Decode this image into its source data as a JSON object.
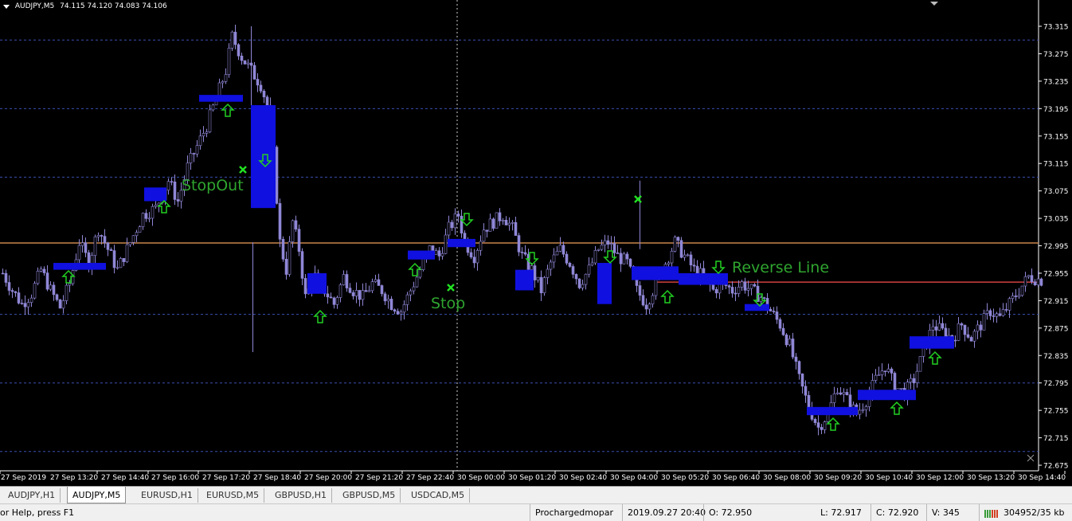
{
  "header": {
    "symbol": "AUDJPY,M5",
    "quote": "74.115 74.120 74.083 74.106"
  },
  "chart_data": {
    "type": "candlestick",
    "symbol": "AUDJPY",
    "timeframe": "M5",
    "y_ticks": [
      "73.315",
      "73.275",
      "73.235",
      "73.195",
      "73.155",
      "73.115",
      "73.075",
      "73.035",
      "72.995",
      "72.955",
      "72.915",
      "72.875",
      "72.835",
      "72.795",
      "72.755",
      "72.715",
      "72.675"
    ],
    "ylim": [
      72.675,
      73.315
    ],
    "x_ticks": [
      "27 Sep 2019",
      "27 Sep 13:20",
      "27 Sep 14:40",
      "27 Sep 16:00",
      "27 Sep 17:20",
      "27 Sep 18:40",
      "27 Sep 20:00",
      "27 Sep 21:20",
      "27 Sep 22:40",
      "30 Sep 00:00",
      "30 Sep 01:20",
      "30 Sep 02:40",
      "30 Sep 04:00",
      "30 Sep 05:20",
      "30 Sep 06:40",
      "30 Sep 08:00",
      "30 Sep 09:20",
      "30 Sep 10:40",
      "30 Sep 12:00",
      "30 Sep 13:20",
      "30 Sep 14:40"
    ],
    "price_path": [
      [
        0,
        72.955
      ],
      [
        3,
        72.93
      ],
      [
        6,
        72.91
      ],
      [
        9,
        72.925
      ],
      [
        12,
        72.96
      ],
      [
        15,
        72.93
      ],
      [
        18,
        72.905
      ],
      [
        21,
        72.94
      ],
      [
        24,
        73.0
      ],
      [
        27,
        72.97
      ],
      [
        30,
        73.02
      ],
      [
        33,
        72.99
      ],
      [
        36,
        72.96
      ],
      [
        40,
        73.0
      ],
      [
        44,
        73.04
      ],
      [
        48,
        73.05
      ],
      [
        52,
        73.09
      ],
      [
        55,
        73.06
      ],
      [
        58,
        73.11
      ],
      [
        61,
        73.14
      ],
      [
        64,
        73.17
      ],
      [
        67,
        73.21
      ],
      [
        70,
        73.25
      ],
      [
        72,
        73.3
      ],
      [
        75,
        73.27
      ],
      [
        78,
        73.25
      ],
      [
        81,
        73.23
      ],
      [
        83,
        73.2
      ],
      [
        85,
        73.13
      ],
      [
        87,
        73.0
      ],
      [
        89,
        72.96
      ],
      [
        91,
        73.03
      ],
      [
        93,
        72.99
      ],
      [
        95,
        72.92
      ],
      [
        98,
        72.95
      ],
      [
        101,
        72.93
      ],
      [
        104,
        72.91
      ],
      [
        107,
        72.95
      ],
      [
        110,
        72.93
      ],
      [
        113,
        72.92
      ],
      [
        116,
        72.94
      ],
      [
        119,
        72.93
      ],
      [
        122,
        72.91
      ],
      [
        125,
        72.9
      ],
      [
        128,
        72.93
      ],
      [
        131,
        72.96
      ],
      [
        134,
        72.99
      ],
      [
        137,
        72.98
      ],
      [
        140,
        73.02
      ],
      [
        143,
        73.04
      ],
      [
        145,
        73.0
      ],
      [
        148,
        72.98
      ],
      [
        151,
        73.02
      ],
      [
        154,
        73.03
      ],
      [
        157,
        73.04
      ],
      [
        160,
        73.02
      ],
      [
        163,
        72.98
      ],
      [
        166,
        72.96
      ],
      [
        169,
        72.93
      ],
      [
        172,
        72.97
      ],
      [
        175,
        72.99
      ],
      [
        178,
        72.97
      ],
      [
        181,
        72.94
      ],
      [
        184,
        72.96
      ],
      [
        187,
        72.99
      ],
      [
        190,
        73.0
      ],
      [
        193,
        72.98
      ],
      [
        196,
        72.97
      ],
      [
        199,
        72.93
      ],
      [
        202,
        72.91
      ],
      [
        205,
        72.94
      ],
      [
        208,
        72.97
      ],
      [
        211,
        73.0
      ],
      [
        214,
        72.98
      ],
      [
        217,
        72.96
      ],
      [
        220,
        72.95
      ],
      [
        223,
        72.93
      ],
      [
        226,
        72.94
      ],
      [
        229,
        72.93
      ],
      [
        232,
        72.94
      ],
      [
        235,
        72.93
      ],
      [
        238,
        72.92
      ],
      [
        241,
        72.9
      ],
      [
        244,
        72.88
      ],
      [
        247,
        72.85
      ],
      [
        250,
        72.8
      ],
      [
        253,
        72.76
      ],
      [
        256,
        72.73
      ],
      [
        259,
        72.75
      ],
      [
        262,
        72.79
      ],
      [
        265,
        72.77
      ],
      [
        268,
        72.75
      ],
      [
        271,
        72.77
      ],
      [
        274,
        72.8
      ],
      [
        277,
        72.82
      ],
      [
        280,
        72.79
      ],
      [
        283,
        72.78
      ],
      [
        286,
        72.8
      ],
      [
        289,
        72.84
      ],
      [
        292,
        72.88
      ],
      [
        295,
        72.87
      ],
      [
        298,
        72.86
      ],
      [
        301,
        72.88
      ],
      [
        304,
        72.86
      ],
      [
        307,
        72.88
      ],
      [
        310,
        72.9
      ],
      [
        313,
        72.89
      ],
      [
        316,
        72.91
      ],
      [
        319,
        72.93
      ],
      [
        322,
        72.95
      ],
      [
        326,
        72.945
      ]
    ],
    "horizontal_lines": [
      {
        "price": 72.999,
        "color": "#c8864a",
        "label": "current-price-line"
      },
      {
        "price": 72.942,
        "color": "#d04040",
        "label": "Reverse Line",
        "x_start_fraction": 0.63
      }
    ],
    "annotations": [
      {
        "text": "StopOut",
        "color": "#2fa52f"
      },
      {
        "text": "Stop",
        "color": "#2fa52f"
      },
      {
        "text": "Reverse Line",
        "color": "#2fa52f"
      }
    ],
    "signal_boxes": [
      {
        "kind": "buy",
        "lo": 72.96,
        "hi": 72.97
      },
      {
        "kind": "buy",
        "lo": 73.06,
        "hi": 73.08
      },
      {
        "kind": "buy",
        "lo": 73.205,
        "hi": 73.215
      },
      {
        "kind": "sell",
        "lo": 73.05,
        "hi": 73.2
      },
      {
        "kind": "buy",
        "lo": 72.925,
        "hi": 72.955
      },
      {
        "kind": "buy",
        "lo": 72.975,
        "hi": 72.988
      },
      {
        "kind": "sell",
        "lo": 72.993,
        "hi": 73.005
      },
      {
        "kind": "sell",
        "lo": 72.93,
        "hi": 72.96
      },
      {
        "kind": "sell",
        "lo": 72.91,
        "hi": 72.97
      },
      {
        "kind": "sell",
        "lo": 72.945,
        "hi": 72.965
      },
      {
        "kind": "sell",
        "lo": 72.938,
        "hi": 72.955
      },
      {
        "kind": "sell",
        "lo": 72.9,
        "hi": 72.91
      },
      {
        "kind": "buy",
        "lo": 72.748,
        "hi": 72.76
      },
      {
        "kind": "buy",
        "lo": 72.77,
        "hi": 72.785
      },
      {
        "kind": "buy",
        "lo": 72.845,
        "hi": 72.863
      }
    ],
    "arrows": {
      "up_count": 12,
      "down_count": 5
    },
    "stop_markers": 3,
    "grid": true,
    "background": "#000000",
    "candle_color": "#8f87d6"
  },
  "tabs": [
    {
      "label": "AUDJPY,H1",
      "active": false
    },
    {
      "label": "AUDJPY,M5",
      "active": true
    },
    {
      "label": "EURUSD,H1",
      "active": false
    },
    {
      "label": "EURUSD,M5",
      "active": false
    },
    {
      "label": "GBPUSD,H1",
      "active": false
    },
    {
      "label": "GBPUSD,M5",
      "active": false
    },
    {
      "label": "USDCAD,M5",
      "active": false
    }
  ],
  "status": {
    "help": "or Help, press F1",
    "profile": "Prochargedmopar",
    "datetime": "2019.09.27 20:40",
    "open": "O: 72.950",
    "low": "L: 72.917",
    "close": "C: 72.920",
    "volume": "V: 345",
    "traffic": "304952/35 kb"
  }
}
